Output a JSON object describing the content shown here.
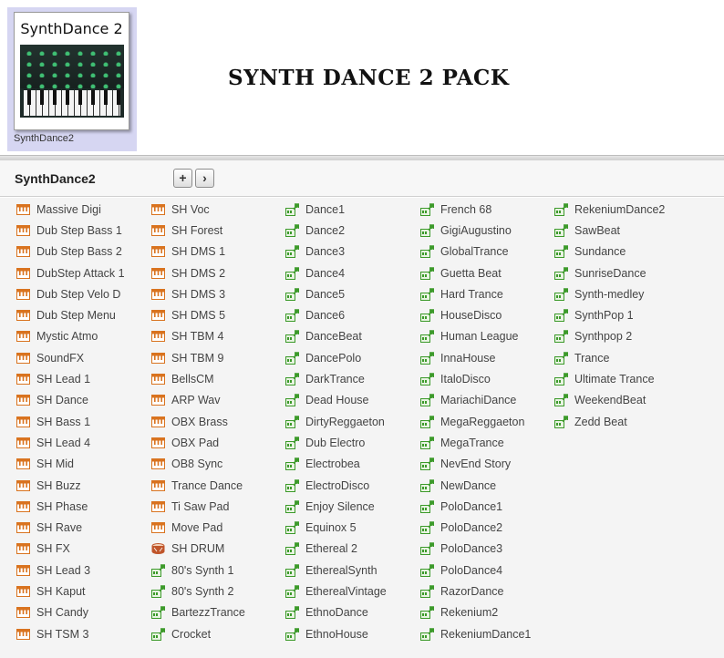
{
  "thumbnail": {
    "title": "SynthDance 2",
    "caption": "SynthDance2"
  },
  "pack_title": "SYNTH DANCE 2 PACK",
  "toolbar": {
    "folder_name": "SynthDance2",
    "add_label": "+",
    "next_label": "›"
  },
  "colors": {
    "instrument": "#d9731f",
    "drum": "#c0552a",
    "pattern": "#3c9a2a"
  },
  "columns": [
    {
      "items": [
        {
          "label": "Massive Digi",
          "icon": "keyboard-icon"
        },
        {
          "label": "Dub Step Bass 1",
          "icon": "keyboard-icon"
        },
        {
          "label": "Dub Step Bass 2",
          "icon": "keyboard-icon"
        },
        {
          "label": "DubStep Attack 1",
          "icon": "keyboard-icon"
        },
        {
          "label": "Dub Step Velo D",
          "icon": "keyboard-icon"
        },
        {
          "label": "Dub Step Menu",
          "icon": "keyboard-icon"
        },
        {
          "label": "Mystic Atmo",
          "icon": "keyboard-icon"
        },
        {
          "label": "SoundFX",
          "icon": "keyboard-icon"
        },
        {
          "label": "SH Lead 1",
          "icon": "keyboard-icon"
        },
        {
          "label": "SH Dance",
          "icon": "keyboard-icon"
        },
        {
          "label": "SH Bass 1",
          "icon": "keyboard-icon"
        },
        {
          "label": "SH Lead 4",
          "icon": "keyboard-icon"
        },
        {
          "label": "SH Mid",
          "icon": "keyboard-icon"
        },
        {
          "label": "SH Buzz",
          "icon": "keyboard-icon"
        },
        {
          "label": "SH Phase",
          "icon": "keyboard-icon"
        },
        {
          "label": "SH Rave",
          "icon": "keyboard-icon"
        },
        {
          "label": "SH FX",
          "icon": "keyboard-icon"
        },
        {
          "label": "SH Lead 3",
          "icon": "keyboard-icon"
        },
        {
          "label": "SH Kaput",
          "icon": "keyboard-icon"
        },
        {
          "label": "SH Candy",
          "icon": "keyboard-icon"
        },
        {
          "label": "SH TSM 3",
          "icon": "keyboard-icon"
        }
      ]
    },
    {
      "items": [
        {
          "label": "SH Voc",
          "icon": "keyboard-icon"
        },
        {
          "label": "SH Forest",
          "icon": "keyboard-icon"
        },
        {
          "label": "SH DMS 1",
          "icon": "keyboard-icon"
        },
        {
          "label": "SH DMS 2",
          "icon": "keyboard-icon"
        },
        {
          "label": "SH DMS 3",
          "icon": "keyboard-icon"
        },
        {
          "label": "SH DMS 5",
          "icon": "keyboard-icon"
        },
        {
          "label": "SH TBM 4",
          "icon": "keyboard-icon"
        },
        {
          "label": "SH TBM 9",
          "icon": "keyboard-icon"
        },
        {
          "label": "BellsCM",
          "icon": "keyboard-icon"
        },
        {
          "label": "ARP Wav",
          "icon": "keyboard-icon"
        },
        {
          "label": "OBX Brass",
          "icon": "keyboard-icon"
        },
        {
          "label": "OBX Pad",
          "icon": "keyboard-icon"
        },
        {
          "label": "OB8 Sync",
          "icon": "keyboard-icon"
        },
        {
          "label": "Trance Dance",
          "icon": "keyboard-icon"
        },
        {
          "label": "Ti Saw Pad",
          "icon": "keyboard-icon"
        },
        {
          "label": "Move Pad",
          "icon": "keyboard-icon"
        },
        {
          "label": "SH DRUM",
          "icon": "drum-icon"
        },
        {
          "label": "80's Synth 1",
          "icon": "pattern-icon"
        },
        {
          "label": "80's Synth 2",
          "icon": "pattern-icon"
        },
        {
          "label": "BartezzTrance",
          "icon": "pattern-icon"
        },
        {
          "label": "Crocket",
          "icon": "pattern-icon"
        }
      ]
    },
    {
      "items": [
        {
          "label": "Dance1",
          "icon": "pattern-icon"
        },
        {
          "label": "Dance2",
          "icon": "pattern-icon"
        },
        {
          "label": "Dance3",
          "icon": "pattern-icon"
        },
        {
          "label": "Dance4",
          "icon": "pattern-icon"
        },
        {
          "label": "Dance5",
          "icon": "pattern-icon"
        },
        {
          "label": "Dance6",
          "icon": "pattern-icon"
        },
        {
          "label": "DanceBeat",
          "icon": "pattern-icon"
        },
        {
          "label": "DancePolo",
          "icon": "pattern-icon"
        },
        {
          "label": "DarkTrance",
          "icon": "pattern-icon"
        },
        {
          "label": "Dead House",
          "icon": "pattern-icon"
        },
        {
          "label": "DirtyReggaeton",
          "icon": "pattern-icon"
        },
        {
          "label": "Dub Electro",
          "icon": "pattern-icon"
        },
        {
          "label": "Electrobea",
          "icon": "pattern-icon"
        },
        {
          "label": "ElectroDisco",
          "icon": "pattern-icon"
        },
        {
          "label": "Enjoy Silence",
          "icon": "pattern-icon"
        },
        {
          "label": "Equinox 5",
          "icon": "pattern-icon"
        },
        {
          "label": "Ethereal 2",
          "icon": "pattern-icon"
        },
        {
          "label": "EtherealSynth",
          "icon": "pattern-icon"
        },
        {
          "label": "EtherealVintage",
          "icon": "pattern-icon"
        },
        {
          "label": "EthnoDance",
          "icon": "pattern-icon"
        },
        {
          "label": "EthnoHouse",
          "icon": "pattern-icon"
        }
      ]
    },
    {
      "items": [
        {
          "label": "French 68",
          "icon": "pattern-icon"
        },
        {
          "label": "GigiAugustino",
          "icon": "pattern-icon"
        },
        {
          "label": "GlobalTrance",
          "icon": "pattern-icon"
        },
        {
          "label": "Guetta Beat",
          "icon": "pattern-icon"
        },
        {
          "label": "Hard Trance",
          "icon": "pattern-icon"
        },
        {
          "label": "HouseDisco",
          "icon": "pattern-icon"
        },
        {
          "label": "Human League",
          "icon": "pattern-icon"
        },
        {
          "label": "InnaHouse",
          "icon": "pattern-icon"
        },
        {
          "label": "ItaloDisco",
          "icon": "pattern-icon"
        },
        {
          "label": "MariachiDance",
          "icon": "pattern-icon"
        },
        {
          "label": "MegaReggaeton",
          "icon": "pattern-icon"
        },
        {
          "label": "MegaTrance",
          "icon": "pattern-icon"
        },
        {
          "label": "NevEnd Story",
          "icon": "pattern-icon"
        },
        {
          "label": "NewDance",
          "icon": "pattern-icon"
        },
        {
          "label": "PoloDance1",
          "icon": "pattern-icon"
        },
        {
          "label": "PoloDance2",
          "icon": "pattern-icon"
        },
        {
          "label": "PoloDance3",
          "icon": "pattern-icon"
        },
        {
          "label": "PoloDance4",
          "icon": "pattern-icon"
        },
        {
          "label": "RazorDance",
          "icon": "pattern-icon"
        },
        {
          "label": "Rekenium2",
          "icon": "pattern-icon"
        },
        {
          "label": "RekeniumDance1",
          "icon": "pattern-icon"
        }
      ]
    },
    {
      "items": [
        {
          "label": "RekeniumDance2",
          "icon": "pattern-icon"
        },
        {
          "label": "SawBeat",
          "icon": "pattern-icon"
        },
        {
          "label": "Sundance",
          "icon": "pattern-icon"
        },
        {
          "label": "SunriseDance",
          "icon": "pattern-icon"
        },
        {
          "label": "Synth-medley",
          "icon": "pattern-icon"
        },
        {
          "label": "SynthPop 1",
          "icon": "pattern-icon"
        },
        {
          "label": "Synthpop 2",
          "icon": "pattern-icon"
        },
        {
          "label": "Trance",
          "icon": "pattern-icon"
        },
        {
          "label": "Ultimate Trance",
          "icon": "pattern-icon"
        },
        {
          "label": "WeekendBeat",
          "icon": "pattern-icon"
        },
        {
          "label": "Zedd Beat",
          "icon": "pattern-icon"
        }
      ]
    }
  ]
}
